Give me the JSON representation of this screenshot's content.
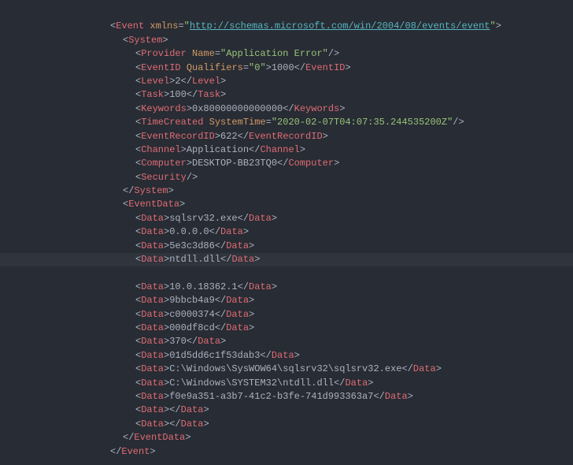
{
  "xml": {
    "root": {
      "tag": "Event",
      "xmlns_attr": "xmlns",
      "xmlns_val": "http://schemas.microsoft.com/win/2004/08/events/event"
    },
    "system": {
      "tag": "System",
      "provider": {
        "tag": "Provider",
        "attr": "Name",
        "val": "Application Error"
      },
      "eventid": {
        "tag": "EventID",
        "attr": "Qualifiers",
        "attrval": "0",
        "text": "1000"
      },
      "level": {
        "tag": "Level",
        "text": "2"
      },
      "task": {
        "tag": "Task",
        "text": "100"
      },
      "keywords": {
        "tag": "Keywords",
        "text": "0x80000000000000"
      },
      "timecreated": {
        "tag": "TimeCreated",
        "attr": "SystemTime",
        "val": "2020-02-07T04:07:35.244535200Z"
      },
      "eventrecordid": {
        "tag": "EventRecordID",
        "text": "622"
      },
      "channel": {
        "tag": "Channel",
        "text": "Application"
      },
      "computer": {
        "tag": "Computer",
        "text": "DESKTOP-BB23TQ0"
      },
      "security": {
        "tag": "Security"
      }
    },
    "eventdata": {
      "tag": "EventData",
      "datatag": "Data",
      "items": [
        "sqlsrv32.exe",
        "0.0.0.0",
        "5e3c3d86",
        "ntdll.dll",
        "10.0.18362.1",
        "9bbcb4a9",
        "c0000374",
        "000df8cd",
        "370",
        "01d5dd6c1f53dab3",
        "C:\\Windows\\SysWOW64\\sqlsrv32\\sqlsrv32.exe",
        "C:\\Windows\\SYSTEM32\\ntdll.dll",
        "f0e9a351-a3b7-41c2-b3fe-741d993363a7",
        "",
        ""
      ]
    }
  }
}
